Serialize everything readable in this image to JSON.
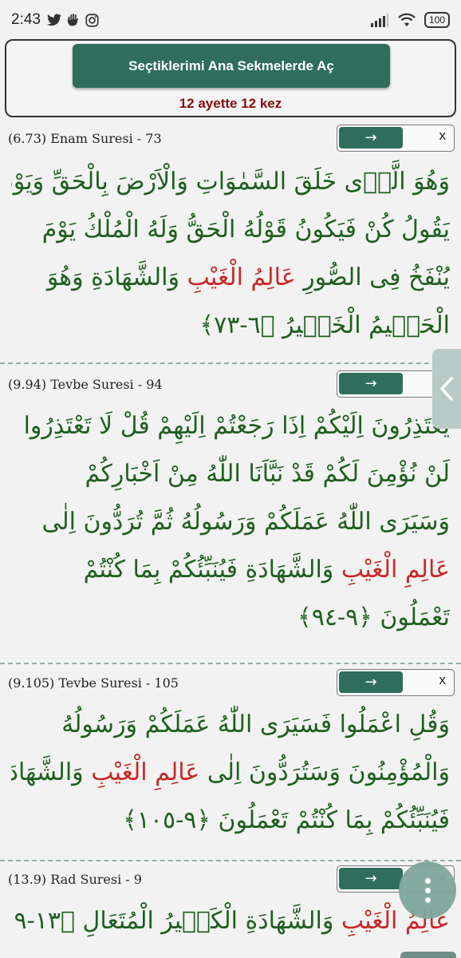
{
  "status_bar": {
    "time": "2:43",
    "battery": "100",
    "left_icons": [
      "twitter-icon",
      "hand-icon",
      "instagram-icon"
    ],
    "right_icons": [
      "signal-icon",
      "wifi-icon",
      "battery-icon"
    ]
  },
  "top_panel": {
    "button_label": "Seçtiklerimi Ana Sekmelerde Aç",
    "summary": "12 ayette 12 kez"
  },
  "controls": {
    "go_symbol": "→",
    "close_symbol": "x"
  },
  "colors": {
    "accent": "#2f6e5c",
    "verse_text": "#1f5f1f",
    "highlight": "#c62828",
    "summary": "#8a0d0d"
  },
  "verses": [
    {
      "reference": "(6.73) Enam Suresi - 73",
      "lines": [
        [
          "وَهُوَ الَّذ۪ى خَلَقَ السَّمٰوَاتِ وَالْاَرْضَ بِالْحَقِّ وَيَوْمَ"
        ],
        [
          "يَقُولُ كُنْ فَيَكُونُ قَوْلُهُ الْحَقُّ وَلَهُ الْمُلْكُ يَوْمَ"
        ],
        [
          "يُنْفَخُ فِى الصُّورِ ",
          "عَالِمُ الْغَيْبِ",
          " وَالشَّهَادَةِ وَهُوَ"
        ],
        [
          "الْحَك۪يمُ الْخَب۪يرُ ﴿٦-٧٣﴾"
        ]
      ]
    },
    {
      "reference": "(9.94) Tevbe Suresi - 94",
      "lines": [
        [
          "يَعْتَذِرُونَ اِلَيْكُمْ اِذَا رَجَعْتُمْ اِلَيْهِمْ قُلْ لَا تَعْتَذِرُوا"
        ],
        [
          "لَنْ نُؤْمِنَ لَكُمْ قَدْ نَبَّاَنَا اللّٰهُ مِنْ اَخْبَارِكُمْ"
        ],
        [
          "وَسَيَرَى اللّٰهُ عَمَلَكُمْ وَرَسُولُهُ ثُمَّ تُرَدُّونَ اِلٰى"
        ],
        [
          "عَالِمِ الْغَيْبِ",
          " وَالشَّهَادَةِ فَيُنَبِّئُكُمْ بِمَا كُنْتُمْ"
        ],
        [
          "تَعْمَلُونَ ﴿٩-٩٤﴾"
        ]
      ]
    },
    {
      "reference": "(9.105) Tevbe Suresi - 105",
      "lines": [
        [
          "وَقُلِ اعْمَلُوا فَسَيَرَى اللّٰهُ عَمَلَكُمْ وَرَسُولُهُ"
        ],
        [
          "وَالْمُؤْمِنُونَ وَسَتُرَدُّونَ اِلٰى ",
          "عَالِمِ الْغَيْبِ",
          " وَالشَّهَادَةِ"
        ],
        [
          "فَيُنَبِّئُكُمْ بِمَا كُنْتُمْ تَعْمَلُونَ ﴿٩-١٠٥﴾"
        ]
      ]
    },
    {
      "reference": "(13.9) Rad Suresi - 9",
      "lines": [
        [
          "عَالِمُ الْغَيْبِ",
          " وَالشَّهَادَةِ الْكَب۪يرُ الْمُتَعَالِ ﴿١٣-٩﴾"
        ]
      ]
    }
  ]
}
